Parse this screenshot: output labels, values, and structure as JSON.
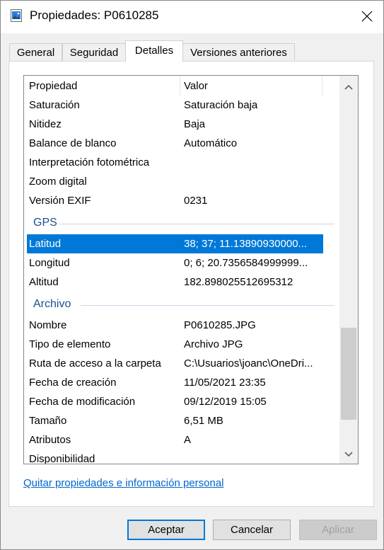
{
  "window": {
    "title": "Propiedades: P0610285"
  },
  "tabs": [
    {
      "label": "General"
    },
    {
      "label": "Seguridad"
    },
    {
      "label": "Detalles",
      "active": true
    },
    {
      "label": "Versiones anteriores"
    }
  ],
  "list": {
    "header": {
      "property": "Propiedad",
      "value": "Valor"
    },
    "camera_rows": [
      {
        "key": "Saturación",
        "value": "Saturación baja"
      },
      {
        "key": "Nitidez",
        "value": "Baja"
      },
      {
        "key": "Balance de blanco",
        "value": "Automático"
      },
      {
        "key": "Interpretación fotométrica",
        "value": ""
      },
      {
        "key": "Zoom digital",
        "value": ""
      },
      {
        "key": "Versión EXIF",
        "value": "0231"
      }
    ],
    "gps_group": "GPS",
    "gps_rows": [
      {
        "key": "Latitud",
        "value": "38; 37; 11.13890930000...",
        "selected": true
      },
      {
        "key": "Longitud",
        "value": "0; 6; 20.7356584999999..."
      },
      {
        "key": "Altitud",
        "value": "182.898025512695312"
      }
    ],
    "file_group": "Archivo",
    "file_rows": [
      {
        "key": "Nombre",
        "value": "P0610285.JPG"
      },
      {
        "key": "Tipo de elemento",
        "value": "Archivo JPG"
      },
      {
        "key": "Ruta de acceso a la carpeta",
        "value": "C:\\Usuarios\\joanc\\OneDri..."
      },
      {
        "key": "Fecha de creación",
        "value": "11/05/2021 23:35"
      },
      {
        "key": "Fecha de modificación",
        "value": "09/12/2019 15:05"
      },
      {
        "key": "Tamaño",
        "value": "6,51 MB"
      },
      {
        "key": "Atributos",
        "value": "A"
      },
      {
        "key": "Disponibilidad",
        "value": ""
      }
    ]
  },
  "remove_link": "Quitar propiedades e información personal",
  "buttons": {
    "ok": "Aceptar",
    "cancel": "Cancelar",
    "apply": "Aplicar"
  },
  "colors": {
    "selection": "#0078d7",
    "group_header": "#1e4e8c",
    "link": "#0066cc"
  },
  "icons": {
    "title": "picture-file-icon",
    "close": "close-icon",
    "scroll_up": "chevron-up-icon",
    "scroll_down": "chevron-down-icon"
  }
}
